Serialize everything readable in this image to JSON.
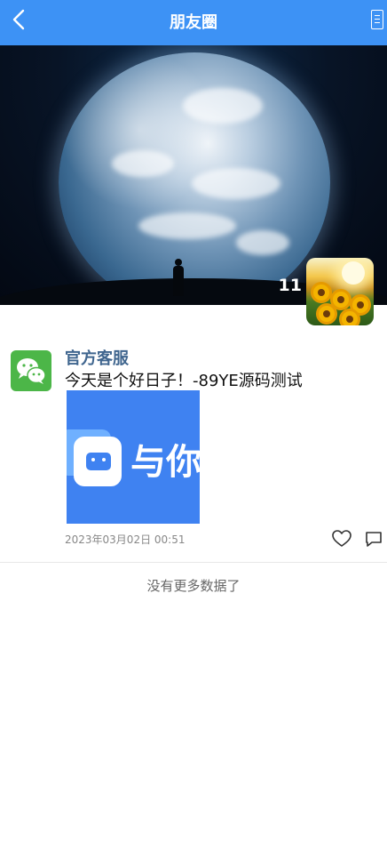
{
  "header": {
    "title": "朋友圈",
    "back_icon": "chevron-left-icon",
    "right_icon": "document-icon"
  },
  "cover": {
    "count": "11"
  },
  "post": {
    "author": "官方客服",
    "content": "今天是个好日子！-89YE源码测试",
    "image_text": "与你",
    "time": "2023年03月02日 00:51",
    "like_icon": "heart-icon",
    "comment_icon": "comment-icon"
  },
  "footer": {
    "no_more": "没有更多数据了"
  },
  "colors": {
    "header_bg": "#3d92f5",
    "author_name": "#3f658e",
    "wechat_green": "#4cb648",
    "image_bg": "#3f82f1"
  }
}
